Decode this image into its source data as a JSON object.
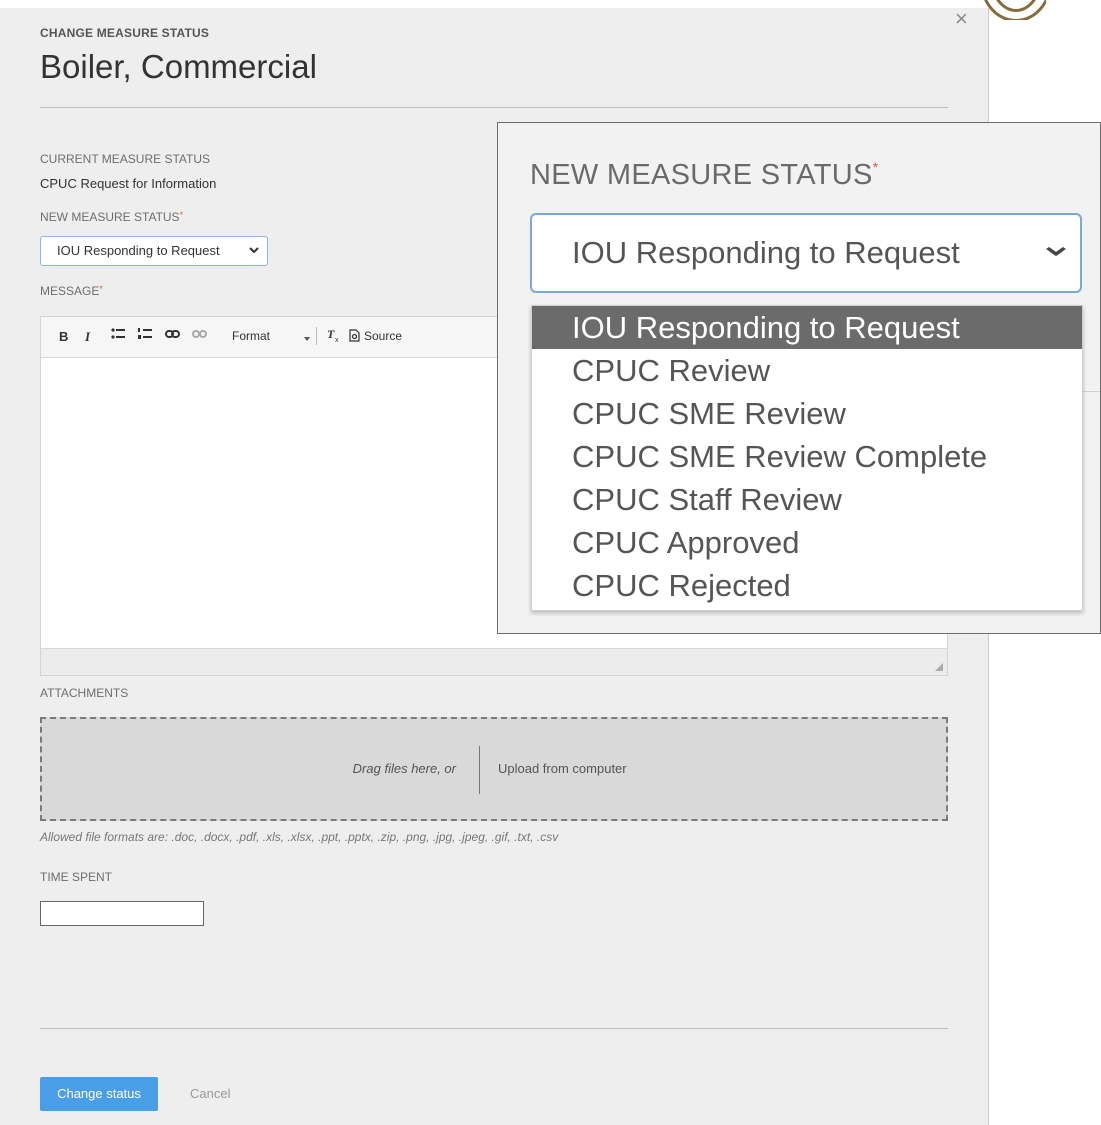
{
  "modal": {
    "kicker": "CHANGE MEASURE STATUS",
    "title": "Boiler, Commercial",
    "close_icon": "×"
  },
  "current_status": {
    "label": "CURRENT MEASURE STATUS",
    "value": "CPUC Request for Information"
  },
  "new_status": {
    "label": "NEW MEASURE STATUS",
    "required_mark": "*",
    "selected": "IOU Responding to Request"
  },
  "message": {
    "label": "MESSAGE",
    "required_mark": "*",
    "toolbar": {
      "bold": "B",
      "italic": "I",
      "format": "Format",
      "source": "Source"
    }
  },
  "attachments": {
    "label": "ATTACHMENTS",
    "drag_text": "Drag files here, or",
    "upload_text": "Upload from computer",
    "allowed_formats": "Allowed file formats are: .doc, .docx, .pdf, .xls, .xlsx, .ppt, .pptx, .zip, .png, .jpg, .jpeg, .gif, .txt, .csv"
  },
  "time_spent": {
    "label": "TIME SPENT",
    "value": ""
  },
  "actions": {
    "submit": "Change status",
    "cancel": "Cancel"
  },
  "zoom_callout": {
    "label": "NEW MEASURE STATUS",
    "required_mark": "*",
    "selected": "IOU Responding to Request",
    "options": [
      "IOU Responding to Request",
      "CPUC Review",
      "CPUC SME Review",
      "CPUC SME Review Complete",
      "CPUC Staff Review",
      "CPUC Approved",
      "CPUC Rejected"
    ],
    "highlighted_index": 0
  },
  "colors": {
    "primary": "#4a9ee8",
    "required": "#e25b3b",
    "option_highlight": "#6b6b6b"
  }
}
